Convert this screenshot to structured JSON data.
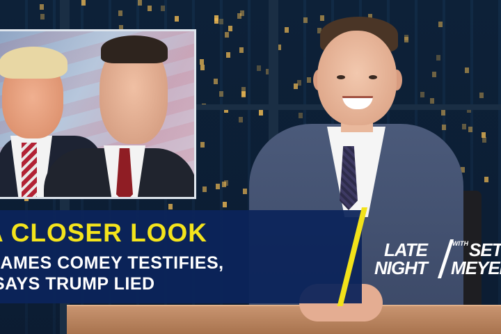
{
  "lower_third": {
    "title": "A CLOSER LOOK",
    "line1": "JAMES COMEY TESTIFIES,",
    "line2": "SAYS TRUMP LIED"
  },
  "logo": {
    "late": "LATE",
    "with": "WITH",
    "seth": "SETH",
    "night": "NIGHT",
    "meyers": "MEYERS"
  },
  "colors": {
    "banner_blue": "#0c245a",
    "accent_yellow": "#f4e41c",
    "text_white": "#ffffff"
  }
}
